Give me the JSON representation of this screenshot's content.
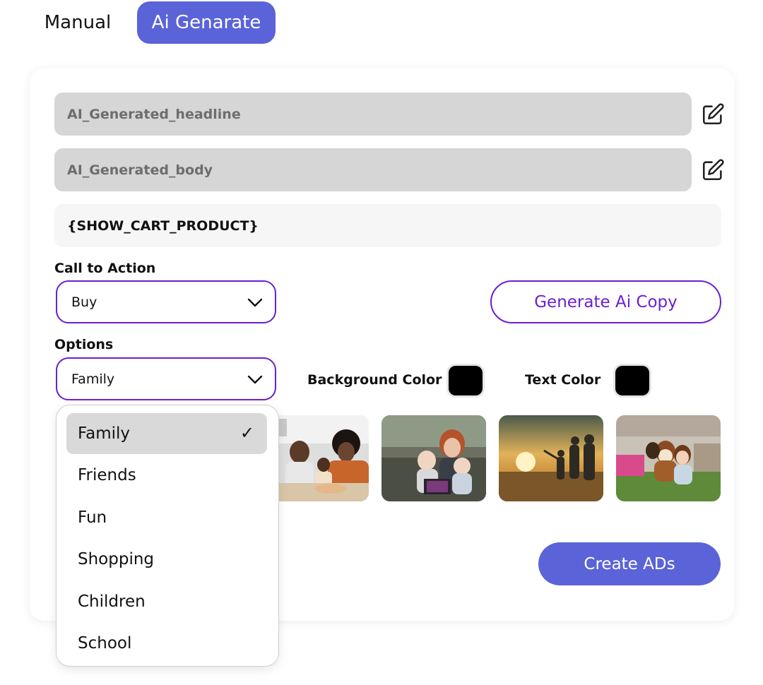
{
  "tabs": {
    "manual": "Manual",
    "ai": "Ai Genarate"
  },
  "fields": {
    "headline": "AI_Generated_headline",
    "body": "AI_Generated_body",
    "product": "{SHOW_CART_PRODUCT}"
  },
  "cta": {
    "label": "Call to Action",
    "value": "Buy"
  },
  "generate_button": "Generate Ai Copy",
  "options": {
    "label": "Options",
    "value": "Family"
  },
  "colors": {
    "background_label": "Background Color",
    "background_value": "#000000",
    "text_label": "Text Color",
    "text_value": "#000000",
    "accent": "#5b63d8",
    "outline": "#6a1fd1"
  },
  "dropdown": {
    "items": [
      "Family",
      "Friends",
      "Fun",
      "Shopping",
      "Children",
      "School"
    ],
    "selected": "Family",
    "check": "✓"
  },
  "create_button": "Create ADs"
}
